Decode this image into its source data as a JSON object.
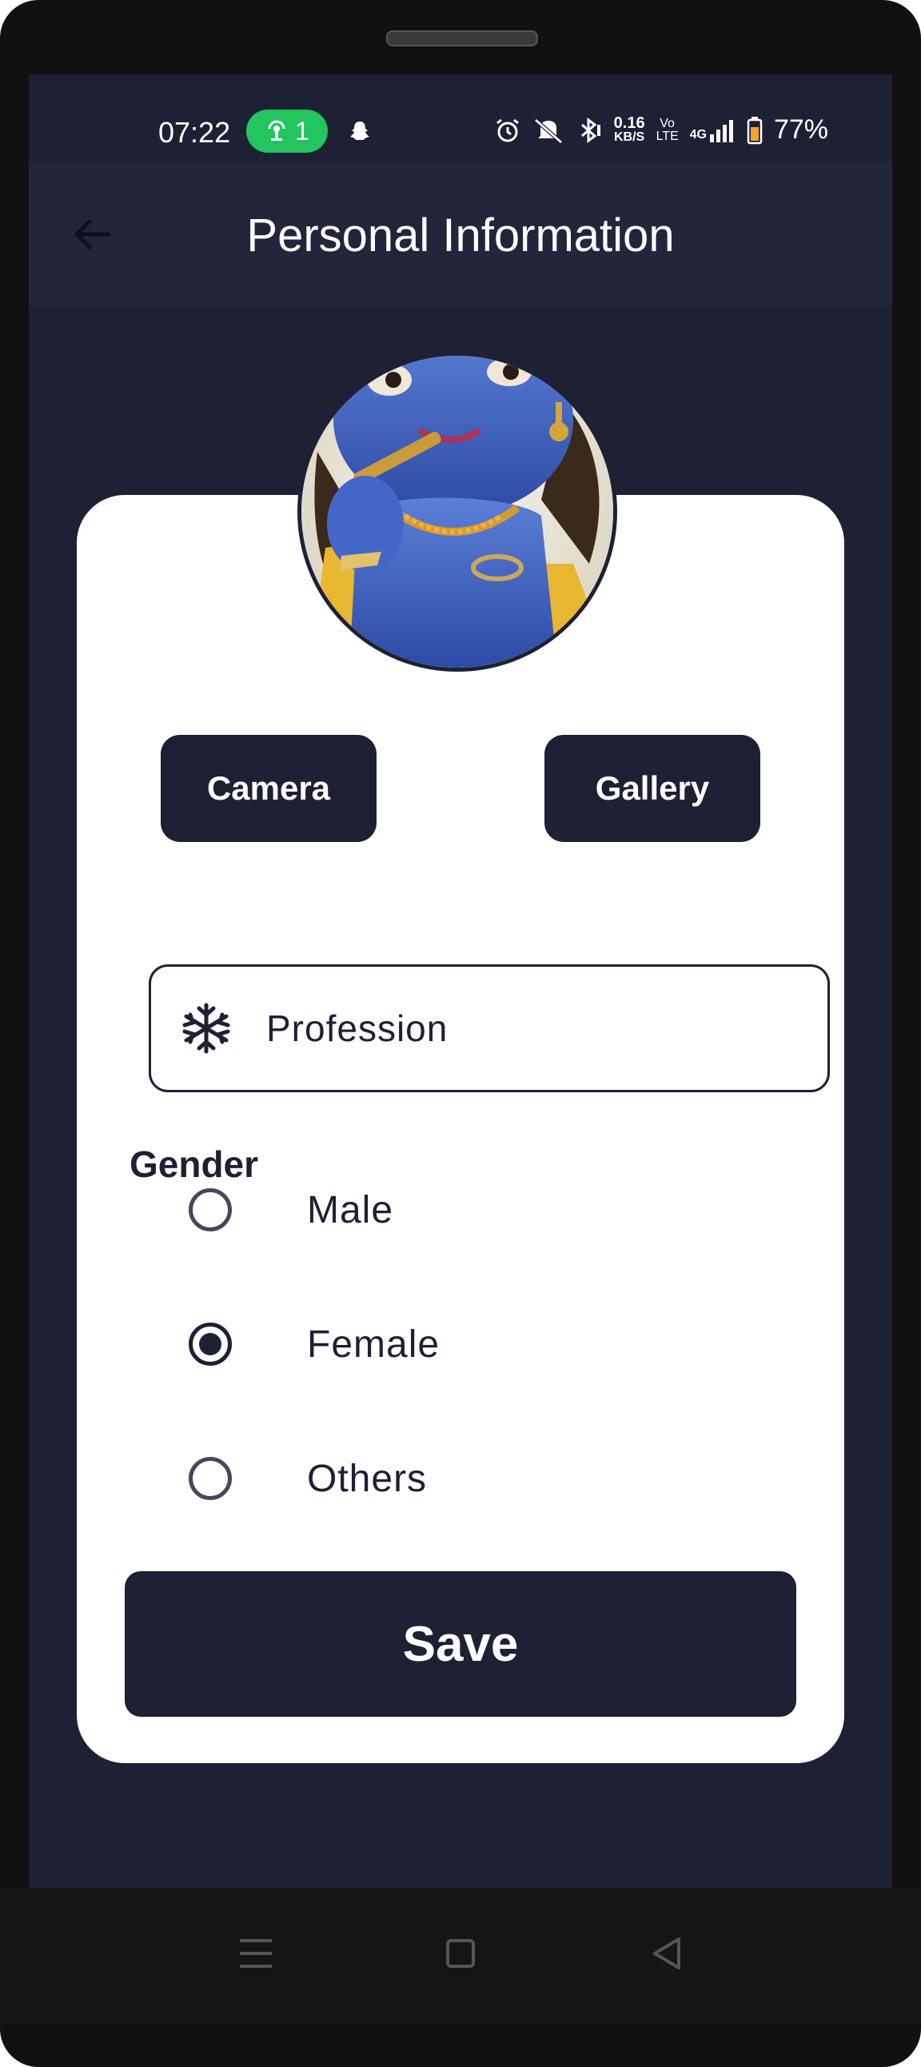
{
  "status_bar": {
    "time": "07:22",
    "hotspot_count": "1",
    "net_speed_value": "0.16",
    "net_speed_unit": "KB/S",
    "volte": "Vo LTE",
    "network": "4G",
    "battery": "77%",
    "icons": [
      "hotspot-icon",
      "snapchat-icon",
      "alarm-icon",
      "mute-icon",
      "bluetooth-icon",
      "signal-icon",
      "battery-icon"
    ]
  },
  "app_bar": {
    "title": "Personal Information",
    "back_icon": "arrow-back-icon"
  },
  "photo": {
    "camera_label": "Camera",
    "gallery_label": "Gallery"
  },
  "profession_field": {
    "label": "Profession",
    "icon": "snowflake-icon"
  },
  "gender": {
    "title": "Gender",
    "options": [
      {
        "label": "Male",
        "selected": false
      },
      {
        "label": "Female",
        "selected": true
      },
      {
        "label": "Others",
        "selected": false
      }
    ]
  },
  "save_label": "Save",
  "colors": {
    "primary": "#1e2034",
    "hotspot": "#22c55e",
    "card": "#ffffff"
  },
  "nav_icons": [
    "menu-icon",
    "home-icon",
    "back-icon"
  ]
}
